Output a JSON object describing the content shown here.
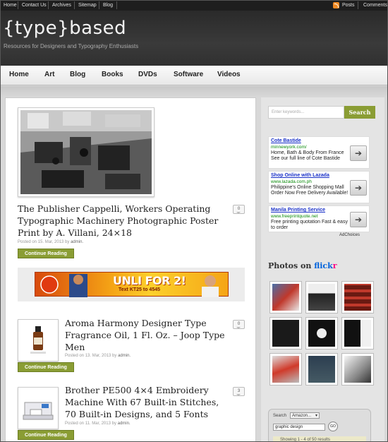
{
  "topbar": {
    "links": [
      "Home",
      "Contact Us",
      "Archives",
      "Sitemap",
      "Blog"
    ],
    "posts_label": "Posts",
    "comments_label": "Comments"
  },
  "header": {
    "logo": "{type}based",
    "tagline": "Resources for Designers and Typography Enthusiasts"
  },
  "nav": {
    "items": [
      "Home",
      "Art",
      "Blog",
      "Books",
      "DVDs",
      "Software",
      "Videos"
    ]
  },
  "posts": [
    {
      "title": "The Publisher Cappelli, Workers Operating Typographic Machinery Photographic Poster Print by A. Villani, 24×18",
      "posted_prefix": "Posted on 15. Mar, 2013 by",
      "author": "admin.",
      "comments": "0",
      "button": "Continue Reading"
    },
    {
      "title": "Aroma Harmony Designer Type Fragrance Oil, 1 Fl. Oz. – Joop Type Men",
      "posted_prefix": "Posted on 13. Mar, 2013 by",
      "author": "admin.",
      "comments": "0",
      "button": "Continue Reading"
    },
    {
      "title": "Brother PE500 4×4 Embroidery Machine With 67 Built-in Stitches, 70 Built-in Designs, and 5 Fonts",
      "posted_prefix": "Posted on 11. Mar, 2013 by",
      "author": "admin.",
      "comments": "3",
      "button": "Continue Reading"
    }
  ],
  "banner": {
    "text": "UNLI FOR 2!",
    "subtext": "Text KT25 to 4545"
  },
  "sidebar": {
    "search_placeholder": "Enter keywords...",
    "search_button": "Search",
    "ads": [
      {
        "title": "Cote Bastide",
        "url": "minnewyork.com/",
        "desc": "Home, Bath & Body From France See our full line of Cote Bastide"
      },
      {
        "title": "Shop Online with Lazada",
        "url": "www.lazada.com.ph",
        "desc": "Philippine's Online Shopping Mall Order Now Free Delivery Available!"
      },
      {
        "title": "Manila Printing Service",
        "url": "www.freeprintquote.net",
        "desc": "Free printing quotation Fast & easy to order"
      }
    ],
    "adchoices": "AdChoices",
    "photos_label": "Photos on",
    "flickr_blue": "flick",
    "flickr_pink": "r",
    "amazon": {
      "search_label": "Search",
      "select_value": "Amazon...",
      "query": "graphic design",
      "go": "GO",
      "results": "Showing 1 - 4 of 50 results"
    }
  },
  "colors": {
    "accent_green": "#8a9d34",
    "link_blue": "#1a31c8",
    "header_dark": "#2a2a2a"
  }
}
